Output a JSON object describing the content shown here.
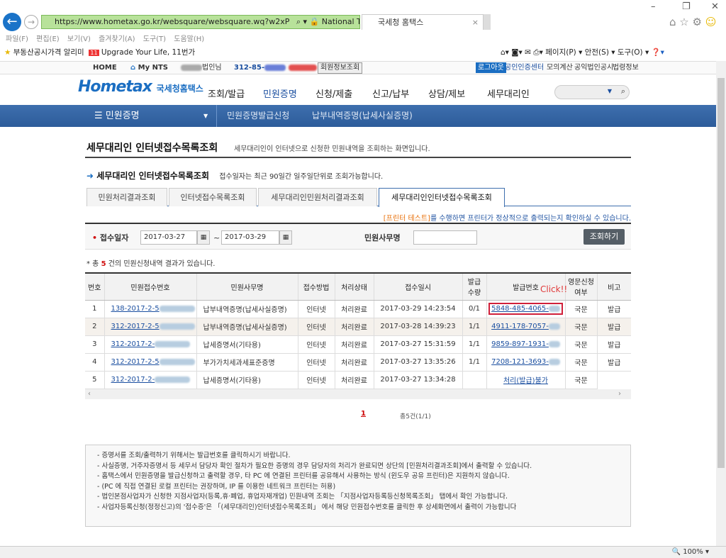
{
  "browser": {
    "url": "https://www.hometax.go.kr/websquare/websquare.wq?w2xP",
    "site_id": "National Tax Service [KR]",
    "tab_title": "국세청 홈택스",
    "menu": [
      "파일(F)",
      "편집(E)",
      "보기(V)",
      "즐겨찾기(A)",
      "도구(T)",
      "도움말(H)"
    ],
    "favorites": [
      "부동산공시가격 알리미",
      "Upgrade Your Life, 11번가"
    ],
    "toolbar": [
      "페이지(P) ▾",
      "안전(S) ▾",
      "도구(O) ▾"
    ],
    "zoom": "100%"
  },
  "sitebar": {
    "home": "HOME",
    "mynts": "My NTS",
    "user_suffix": "법인님",
    "biz_no": "312-85-",
    "member_info": "회원정보조회",
    "logout": "로그아웃",
    "links": [
      "공인인증센터",
      "모의계산",
      "공익법인공시",
      "법령정보"
    ]
  },
  "header": {
    "logo": "Hometax",
    "logo_kr": "국세청홈택스",
    "nav": [
      "조회/발급",
      "민원증명",
      "신청/제출",
      "신고/납부",
      "상담/제보",
      "세무대리인"
    ]
  },
  "bluenav": {
    "menu": "민원증명",
    "crumbs": [
      "민원증명발급신청",
      "납부내역증명(납세사실증명)"
    ]
  },
  "page": {
    "title": "세무대리인 인터넷접수목록조회",
    "subtitle": "세무대리인이 인터넷으로 신청한 민원내역을 조회하는 화면입니다.",
    "section": "세무대리인 인터넷접수목록조회",
    "section_note": "접수일자는 최근 90일간 일주일단위로 조회가능합니다.",
    "tabs": [
      "민원처리결과조회",
      "인터넷접수목록조회",
      "세무대리인민원처리결과조회",
      "세무대리인인터넷접수목록조회"
    ],
    "notice_link": "[프린터 테스트]",
    "notice": "를 수행하면 프린터가 정상적으로 출력되는지 확인하실 수 있습니다."
  },
  "form": {
    "date_label": "접수일자",
    "from": "2017-03-27",
    "to": "2017-03-29",
    "tilde": "~",
    "name_label": "민원사무명",
    "name_value": "",
    "search": "조회하기"
  },
  "result": {
    "prefix": "* 총",
    "count": "5",
    "suffix": "건의 민원신청내역 결과가 있습니다."
  },
  "table": {
    "headers": [
      "번호",
      "민원접수번호",
      "민원사무명",
      "접수방법",
      "처리상태",
      "접수일시",
      "발급\n수량",
      "발급번호",
      "영문신청\n여부",
      "비고"
    ],
    "rows": [
      [
        "1",
        "138-2017-2-5",
        "납부내역증명(납세사실증명)",
        "인터넷",
        "처리완료",
        "2017-03-29 14:23:54",
        "0/1",
        "5848-485-4065-",
        "국문",
        "발급"
      ],
      [
        "2",
        "312-2017-2-5",
        "납부내역증명(납세사실증명)",
        "인터넷",
        "처리완료",
        "2017-03-28 14:39:23",
        "1/1",
        "4911-178-7057-",
        "국문",
        "발급"
      ],
      [
        "3",
        "312-2017-2-",
        "납세증명서(기타용)",
        "인터넷",
        "처리완료",
        "2017-03-27 15:31:59",
        "1/1",
        "9859-897-1931-",
        "국문",
        "발급"
      ],
      [
        "4",
        "312-2017-2-5",
        "부가가치세과세표준증명",
        "인터넷",
        "처리완료",
        "2017-03-27 13:35:26",
        "1/1",
        "7208-121-3693-",
        "국문",
        "발급"
      ],
      [
        "5",
        "312-2017-2-",
        "납세증명서(기타용)",
        "인터넷",
        "처리완료",
        "2017-03-27 13:34:28",
        "",
        "처리(발급)불가",
        "국문",
        ""
      ]
    ]
  },
  "annotation": "Click!!",
  "pagination": {
    "current": "1",
    "total": "총5건(1/1)"
  },
  "notes": [
    "- 증명서를 조회/출력하기 위해서는 발급번호를 클릭하시기 바랍니다.",
    "- 사실증명, 거주자증명서 등 세무서 담당자 확인 절차가 필요한 증명의 경우 담당자의 처리가 완료되면 상단의 [민원처리결과조회]에서 출력할 수 있습니다.",
    "- 홈택스에서 민원증명을 발급신청하고 출력할 경우, 타 PC 에 연결된 프린터를 공유해서 사용하는 방식 (윈도우 공유 프린터)은 지원하지 않습니다.",
    "- (PC 에 직접 연결된 로컬 프린터는 권장하며,  IP 를 이용한 네트워크 프린터는 허용)",
    "- 법인본점사업자가 신청한 지점사업자(등록,휴·폐업, 휴업자재개업) 민원내역 조회는 「지점사업자등록등신청목록조회」 탭에서 확인 가능합니다.",
    "- 사업자등록신청(정정신고)의 '접수증'은  「(세무대리인)인터넷접수목록조회」 에서 해당 민원접수번호를 클릭한 후 상세화면에서 출력이 가능합니다"
  ]
}
